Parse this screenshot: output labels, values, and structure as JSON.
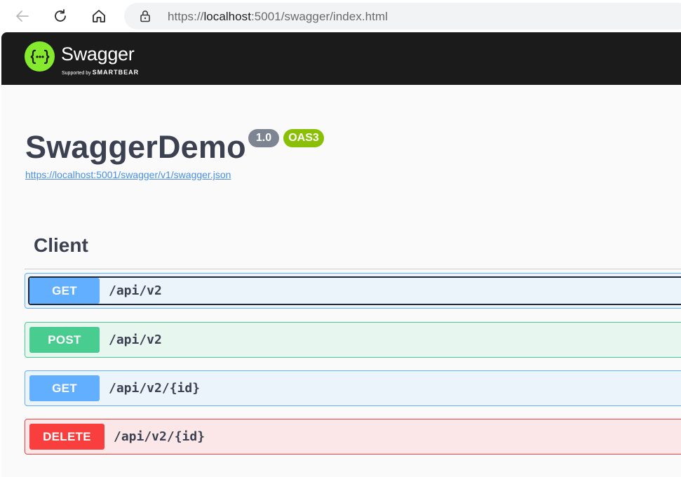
{
  "browser": {
    "url_prefix": "https://",
    "url_host": "localhost",
    "url_rest": ":5001/swagger/index.html"
  },
  "topbar": {
    "brand": "Swagger",
    "supported_prefix": "Supported by",
    "supported_by": "SMARTBEAR",
    "logo_glyph": "{···}"
  },
  "info": {
    "title": "SwaggerDemo",
    "version": "1.0",
    "spec_version": "OAS3",
    "spec_url": "https://localhost:5001/swagger/v1/swagger.json"
  },
  "tag": {
    "name": "Client"
  },
  "operations": [
    {
      "method": "GET",
      "path": "/api/v2"
    },
    {
      "method": "POST",
      "path": "/api/v2"
    },
    {
      "method": "GET",
      "path": "/api/v2/{id}"
    },
    {
      "method": "DELETE",
      "path": "/api/v2/{id}"
    }
  ],
  "colors": {
    "get": "#61affe",
    "post": "#49cc90",
    "delete": "#f93e3e",
    "brand_green": "#85ea2d",
    "topbar_bg": "#1b1b1b"
  },
  "icons": [
    "back-arrow-icon",
    "reload-icon",
    "home-icon",
    "lock-icon",
    "swagger-logo-icon"
  ]
}
